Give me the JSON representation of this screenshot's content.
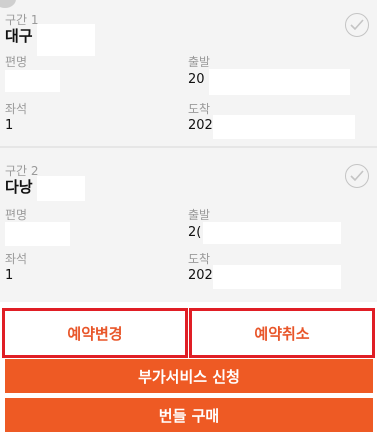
{
  "segments": [
    {
      "section_label": "구간 1",
      "city": "대구",
      "flight_label": "편명",
      "flight_value": "",
      "seat_label": "좌석",
      "seat_value": "1",
      "depart_label": "출발",
      "depart_value": "20",
      "arrive_label": "도착",
      "arrive_value": "202",
      "check_icon": "check-circle-icon"
    },
    {
      "section_label": "구간 2",
      "city": "다낭",
      "flight_label": "편명",
      "flight_value": "",
      "seat_label": "좌석",
      "seat_value": "1",
      "depart_label": "출발",
      "depart_value": "2(",
      "arrive_label": "도착",
      "arrive_value": "202",
      "check_icon": "check-circle-icon"
    }
  ],
  "actions": {
    "change_label": "예약변경",
    "cancel_label": "예약취소",
    "extra_service_label": "부가서비스 신청",
    "bundle_label": "번들 구매"
  },
  "colors": {
    "accent": "#ee5a24",
    "highlight_border": "#e01e25",
    "panel_bg": "#f4f4f4"
  }
}
